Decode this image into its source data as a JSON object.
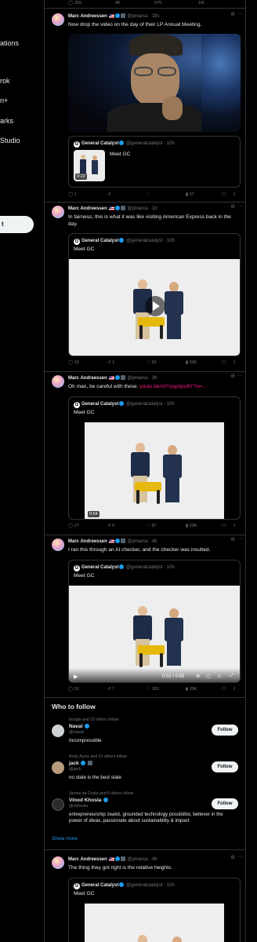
{
  "sidebar": {
    "items": [
      {
        "label": "ations"
      },
      {
        "label": "rok"
      },
      {
        "label": "n+"
      },
      {
        "label": "arks"
      },
      {
        "label": "Studio"
      }
    ],
    "post_label": "t"
  },
  "top_actions": {
    "replies": "355",
    "reposts": "9K",
    "likes": "57K",
    "views": "1M"
  },
  "tweets": [
    {
      "author": "Marc Andreessen",
      "handle": "@pmarca",
      "time": "18s",
      "text": "Now drop the video on the day of their LP Annual Meeting.",
      "quote": {
        "author": "General Catalyst",
        "handle": "@generalcatalyst",
        "time": "10h",
        "text": "Meet GC",
        "duration": "0:22"
      },
      "stats": {
        "replies": "1",
        "reposts": "",
        "likes": "",
        "views": "27"
      }
    },
    {
      "author": "Marc Andreessen",
      "handle": "@pmarca",
      "time": "1h",
      "text": "In fairness, this is what it was like visiting American Express back in the day.",
      "quote": {
        "author": "General Catalyst",
        "handle": "@generalcatalyst",
        "time": "10h",
        "text": "Meet GC"
      },
      "stats": {
        "replies": "15",
        "reposts": "1",
        "likes": "93",
        "views": "20K"
      }
    },
    {
      "author": "Marc Andreessen",
      "handle": "@pmarca",
      "time": "3h",
      "text": "Oh man, be careful with these. ",
      "link": "youtu.be/s0Yyqphpu8Y?si=...",
      "quote": {
        "author": "General Catalyst",
        "handle": "@generalcatalyst",
        "time": "10h",
        "text": "Meet GC",
        "duration": "0:54"
      },
      "stats": {
        "replies": "27",
        "reposts": "6",
        "likes": "97",
        "views": "59K"
      }
    },
    {
      "author": "Marc Andreessen",
      "handle": "@pmarca",
      "time": "4h",
      "text": "I ran this through an AI checker, and the checker was insulted.",
      "quote": {
        "author": "General Catalyst",
        "handle": "@generalcatalyst",
        "time": "10h",
        "text": "Meet GC",
        "timecode": "0:02 / 0:55"
      },
      "stats": {
        "replies": "33",
        "reposts": "7",
        "likes": "183",
        "views": "39K"
      }
    },
    {
      "author": "Marc Andreessen",
      "handle": "@pmarca",
      "time": "4h",
      "text": "The thing they got right is the relative heights.",
      "quote": {
        "author": "General Catalyst",
        "handle": "@generalcatalyst",
        "time": "10h",
        "text": "Meet GC"
      }
    }
  ],
  "who_to_follow": {
    "title": "Who to follow",
    "follow_label": "Follow",
    "show_more": "Show more",
    "users": [
      {
        "social": "boogie and 22 others follow",
        "name": "Naval",
        "handle": "@naval",
        "bio": "Incompressible"
      },
      {
        "social": "Andy Ayrey and 21 others follow",
        "name": "jack",
        "handle": "@jack",
        "bio": "no state is the best state"
      },
      {
        "social": "James da Costa and 6 others follow",
        "name": "Vinod Khosla",
        "handle": "@vkhosla",
        "bio": "entrepreneurship zealot, grounded technology possibilist, believer in the power of ideas, passionate about sustainability & impact"
      }
    ]
  },
  "icons": [
    "reply-icon",
    "repost-icon",
    "like-icon",
    "views-icon",
    "bookmark-icon",
    "share-icon",
    "more-icon",
    "grok-icon",
    "play-icon",
    "verified-icon"
  ],
  "colors": {
    "accent": "#1d9bf0",
    "background": "#000000",
    "border": "#2f3336",
    "muted": "#71767b",
    "link": "#f91880"
  }
}
